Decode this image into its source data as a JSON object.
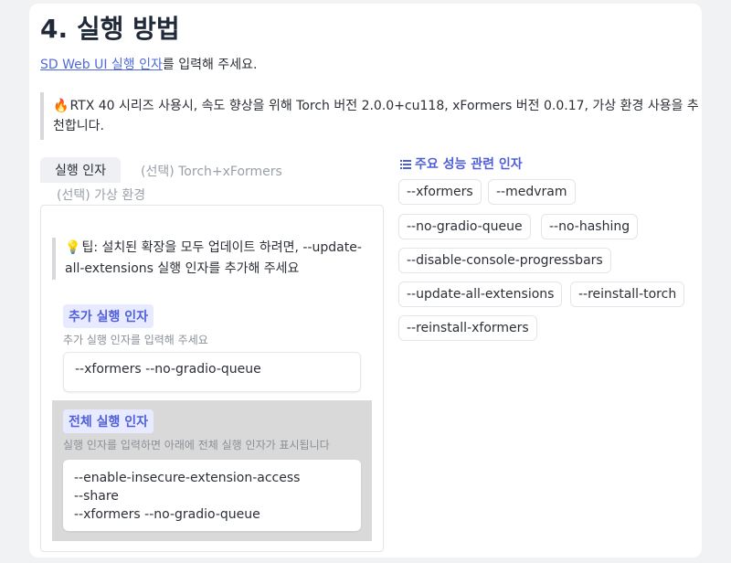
{
  "heading": "4. 실행 방법",
  "intro": {
    "link_text": "SD Web UI 실행 인자",
    "text": "를 입력해 주세요."
  },
  "callout": {
    "emoji": "🔥",
    "text": "RTX 40 시리즈 사용시, 속도 향상을 위해 Torch 버전 2.0.0+cu118, xFormers 버전 0.0.17, 가상 환경 사용을 추천합니다."
  },
  "tabs": [
    "실행 인자",
    "(선택) Torch+xFormers",
    "(선택) 가상 환경"
  ],
  "tip": {
    "emoji": "💡",
    "text": "팁: 설치된 확장을 모두 업데이트 하려면, --update-all-extensions 실행 인자를 추가해 주세요"
  },
  "extra_args": {
    "label": "추가 실행 인자",
    "hint": "추가 실행 인자를 입력해 주세요",
    "value": "--xformers --no-gradio-queue"
  },
  "full_args": {
    "label": "전체 실행 인자",
    "hint": "실행 인자를 입력하면 아래에 전체 실행 인자가 표시됩니다",
    "value": "--enable-insecure-extension-access\n--share\n--xformers --no-gradio-queue"
  },
  "performance": {
    "icon": "list-icon",
    "title": "주요 성능 관련 인자",
    "chips": [
      "--xformers",
      "--medvram",
      "--no-gradio-queue",
      "--no-hashing",
      "--disable-console-progressbars",
      "--update-all-extensions",
      "--reinstall-torch",
      "--reinstall-xformers"
    ]
  },
  "colors": {
    "accent": "#4f5fd8",
    "link": "#4f6bd8",
    "label_bg": "#e8ebff"
  }
}
